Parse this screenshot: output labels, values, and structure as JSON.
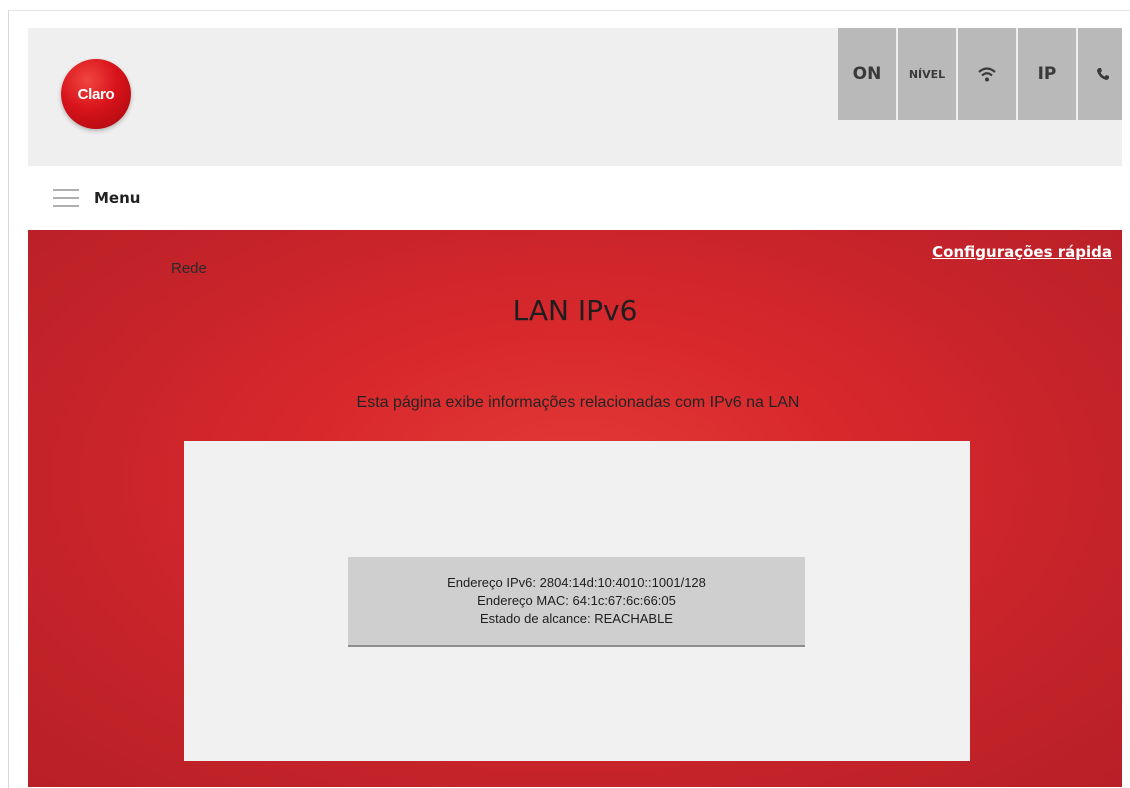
{
  "logo": {
    "text": "Claro"
  },
  "status_bar": {
    "items": [
      {
        "label": "ON",
        "icon": ""
      },
      {
        "label": "NÍVEL",
        "icon": ""
      },
      {
        "label": "",
        "icon": "wifi-icon"
      },
      {
        "label": "IP",
        "icon": ""
      },
      {
        "label": "",
        "icon": "phone-icon"
      }
    ]
  },
  "menu": {
    "label": "Menu"
  },
  "main": {
    "breadcrumb": "Rede",
    "quick_config_link": "Configurações rápida",
    "title": "LAN IPv6",
    "description": "Esta página exibe informações relacionadas com IPv6 na LAN",
    "info": {
      "ipv6_label": "Endereço IPv6:",
      "ipv6_value": "2804:14d:10:4010::1001/128",
      "mac_label": "Endereço MAC:",
      "mac_value": "64:1c:67:6c:66:05",
      "state_label": "Estado de alcance:",
      "state_value": "REACHABLE"
    }
  },
  "colors": {
    "brand_red": "#d8282c",
    "panel_bg": "#f1f1f1",
    "status_btn_bg": "#b9b9b9"
  }
}
